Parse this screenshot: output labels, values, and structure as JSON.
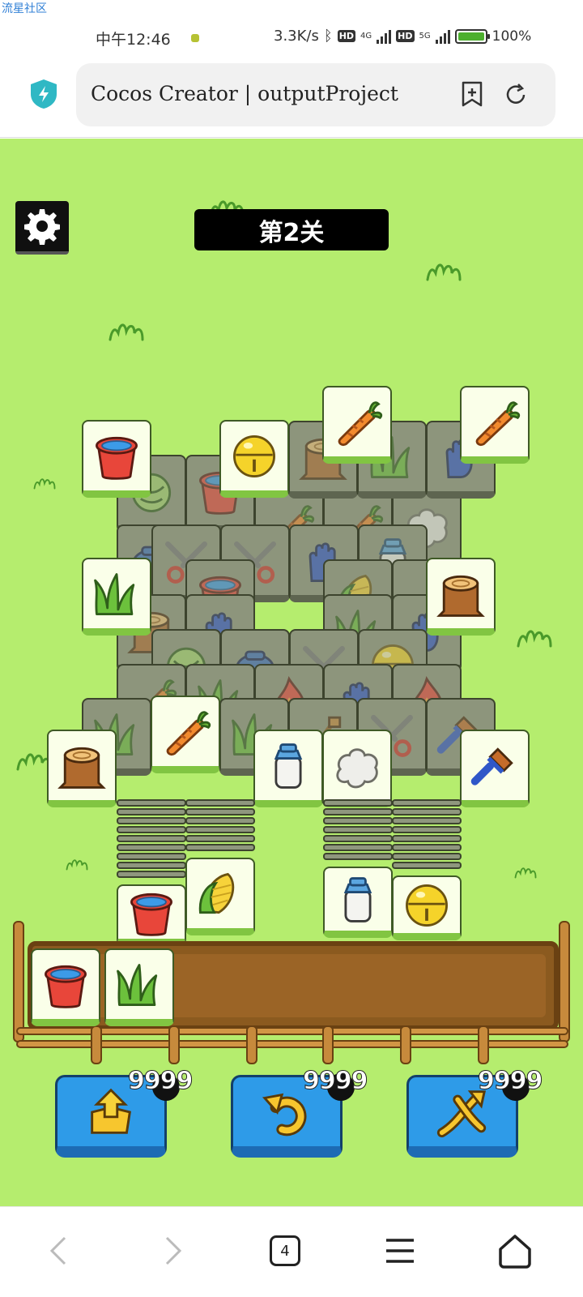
{
  "watermark": "流星社区",
  "status_bar": {
    "time": "中午12:46",
    "speed": "3.3K/s",
    "hd": "HD",
    "net4g": "4G",
    "net5g": "5G",
    "battery": "100%"
  },
  "browser": {
    "url_title": "Cocos Creator | outputProject",
    "icons": [
      "shield-icon",
      "bookmark-add-icon",
      "reload-icon"
    ]
  },
  "game": {
    "level_label": "第2关",
    "settings_icon": "gear-icon",
    "tray_tiles": [
      "bucket",
      "grass"
    ],
    "powerups": [
      {
        "name": "move-out",
        "icon": "box-arrow-up-icon",
        "count": "9999"
      },
      {
        "name": "undo",
        "icon": "undo-arrow-icon",
        "count": "9999"
      },
      {
        "name": "shuffle",
        "icon": "shuffle-arrows-icon",
        "count": "9999"
      }
    ],
    "colors": {
      "background": "#b5ed6e",
      "tile_face": "#faffe9",
      "powerup_blue": "#2e9be8",
      "tray_wood": "#8b5a1f"
    }
  },
  "nav": {
    "tab_count": "4",
    "icons": [
      "back-icon",
      "forward-icon",
      "tabs-icon",
      "menu-icon",
      "home-icon"
    ]
  }
}
